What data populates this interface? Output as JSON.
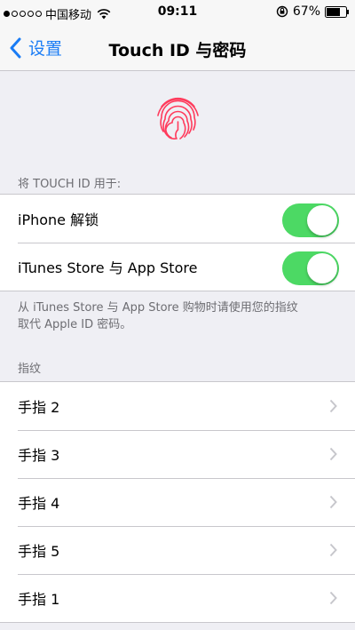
{
  "status_bar": {
    "carrier": "中国移动",
    "time": "09:11",
    "battery": "67%"
  },
  "nav": {
    "back_label": "设置",
    "title": "Touch ID 与密码"
  },
  "touch_id_section": {
    "header": "将 TOUCH ID 用于:",
    "rows": [
      {
        "label": "iPhone 解锁",
        "enabled": true
      },
      {
        "label": "iTunes Store 与 App Store",
        "enabled": true
      }
    ],
    "footnote_line1": "从 iTunes Store 与 App Store 购物时请使用您的指纹",
    "footnote_line2": "取代 Apple ID 密码。"
  },
  "fingerprints_section": {
    "header": "指纹",
    "rows": [
      {
        "label": "手指 2"
      },
      {
        "label": "手指 3"
      },
      {
        "label": "手指 4"
      },
      {
        "label": "手指 5"
      },
      {
        "label": "手指 1"
      }
    ]
  },
  "colors": {
    "accent": "#1a7cf5",
    "toggle_on": "#4cd964",
    "fingerprint": "#ff3b5c"
  }
}
